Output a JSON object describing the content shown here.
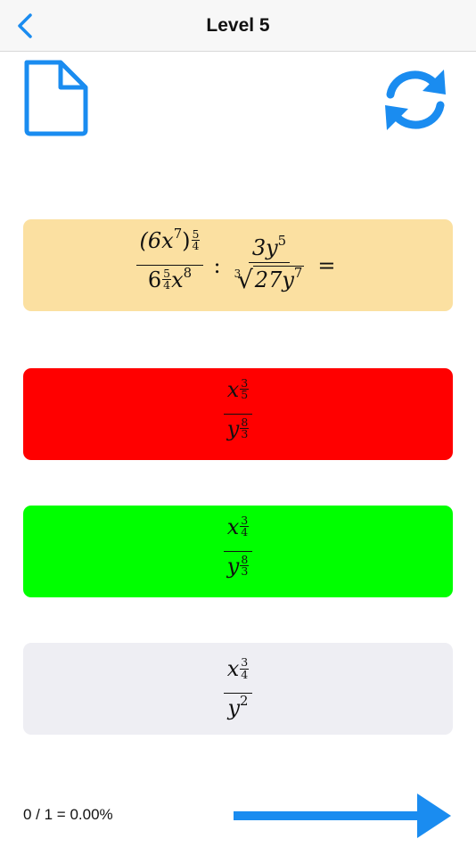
{
  "header": {
    "title": "Level 5",
    "back_icon": "chevron-left-icon"
  },
  "toolbar": {
    "doc_icon": "document-icon",
    "refresh_icon": "refresh-icon"
  },
  "colors": {
    "accent": "#1a8cf0",
    "question_bg": "#fbe0a1",
    "option_wrong": "#ff0000",
    "option_correct": "#00ff00",
    "option_neutral": "#eeeef3"
  },
  "question": {
    "frac1": {
      "num_base": "(6x",
      "num_base_exp": "7",
      "num_close": ")",
      "num_exp_num": "5",
      "num_exp_den": "4",
      "den_base": "6",
      "den_base_exp_num": "5",
      "den_base_exp_den": "4",
      "den_var": "x",
      "den_var_exp": "8"
    },
    "op": ":",
    "frac2": {
      "num": "3y",
      "num_exp": "5",
      "root_index": "3",
      "radicand": "27y",
      "radicand_exp": "7"
    },
    "equals": "="
  },
  "options": [
    {
      "state": "wrong",
      "num_var": "x",
      "num_exp_num": "3",
      "num_exp_den": "5",
      "den_var": "y",
      "den_exp_num": "8",
      "den_exp_den": "3"
    },
    {
      "state": "correct",
      "num_var": "x",
      "num_exp_num": "3",
      "num_exp_den": "4",
      "den_var": "y",
      "den_exp_num": "8",
      "den_exp_den": "3"
    },
    {
      "state": "neutral",
      "num_var": "x",
      "num_exp_num": "3",
      "num_exp_den": "4",
      "den_var": "y",
      "den_exp": "2"
    }
  ],
  "footer": {
    "score": "0 / 1 = 0.00%",
    "next_icon": "arrow-right-icon"
  }
}
